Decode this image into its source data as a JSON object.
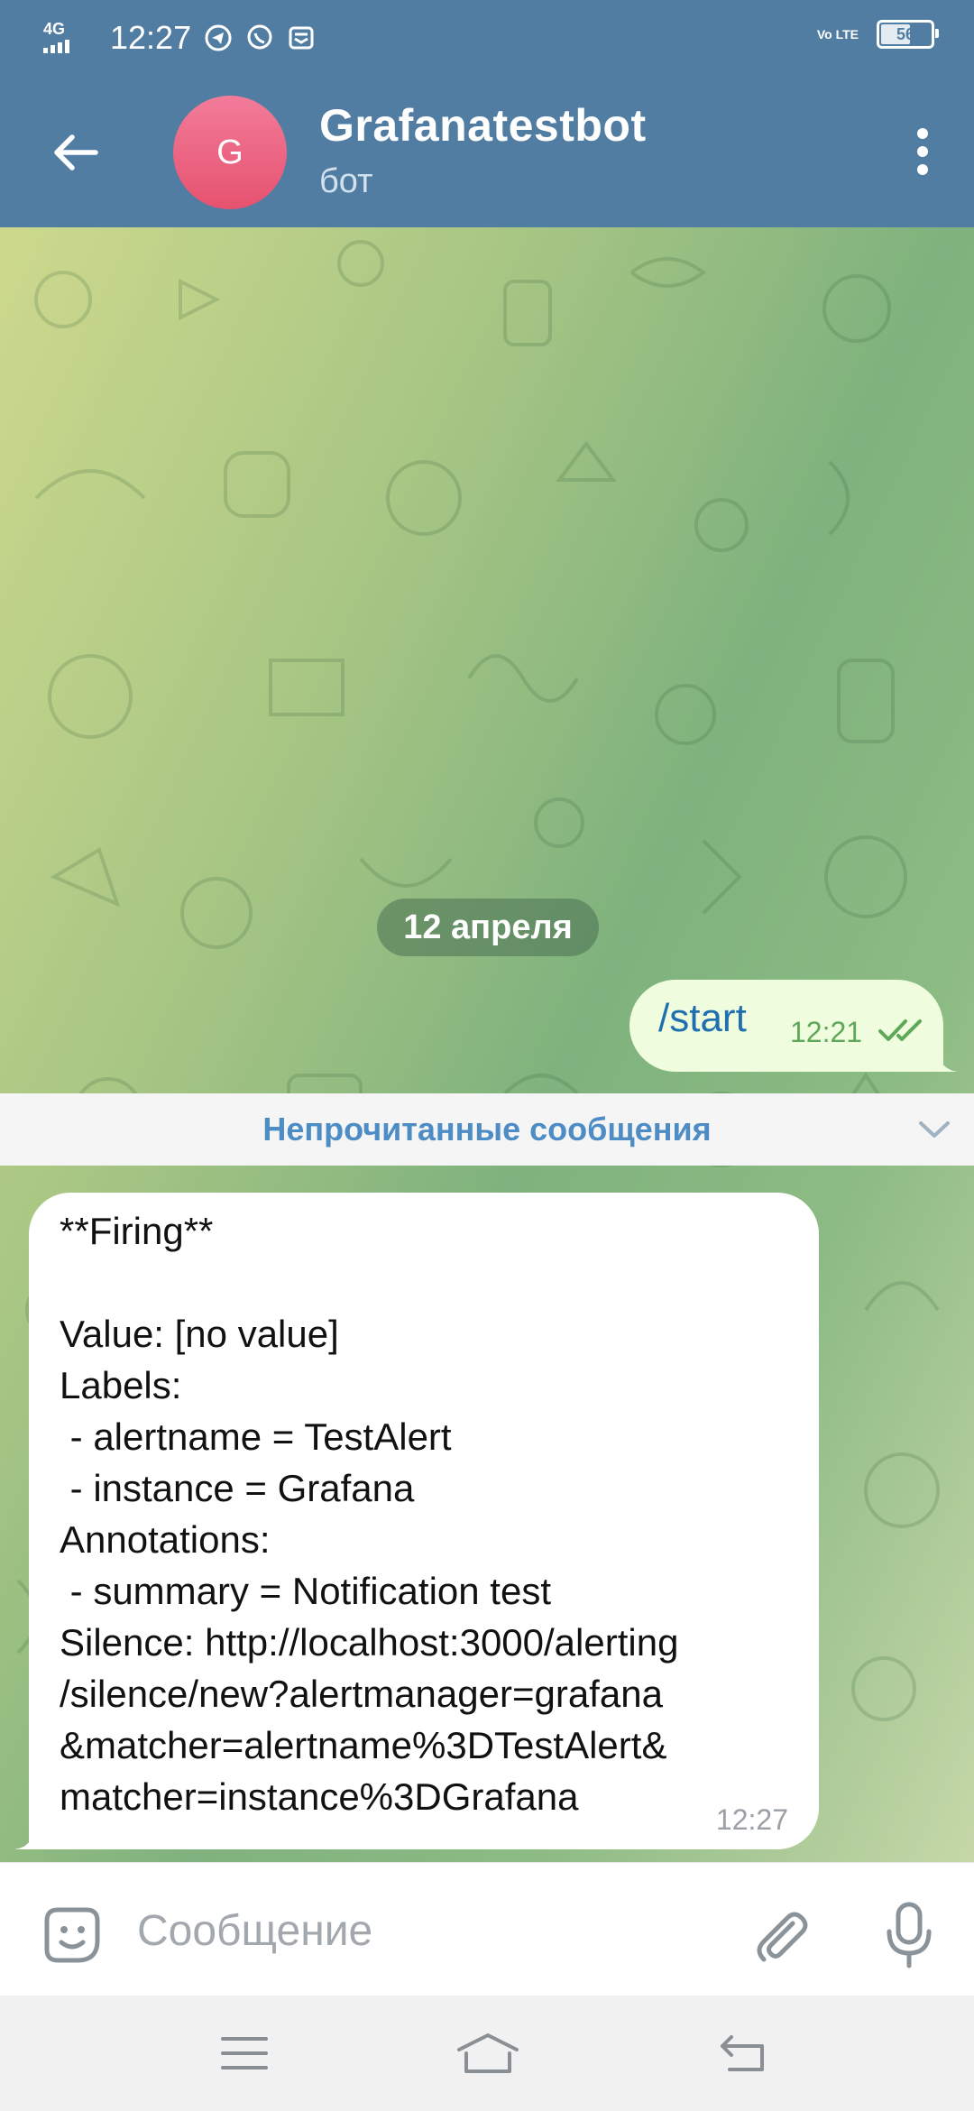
{
  "status_bar": {
    "network": "4G",
    "time": "12:27",
    "volte": "Vo LTE",
    "battery": "56"
  },
  "header": {
    "avatar_letter": "G",
    "title": "Grafanatestbot",
    "subtitle": "бот"
  },
  "chat": {
    "date_separator": "12 апреля",
    "outgoing": {
      "text": "/start",
      "time": "12:21"
    },
    "unread_label": "Непрочитанные сообщения",
    "incoming": {
      "text": "**Firing**\n\nValue: [no value]\nLabels:\n - alertname = TestAlert\n - instance = Grafana\nAnnotations:\n - summary = Notification test\nSilence: http://localhost:3000/alerting\n/silence/new?alertmanager=grafana\n&matcher=alertname%3DTestAlert&\nmatcher=instance%3DGrafana",
      "time": "12:27"
    }
  },
  "composer": {
    "placeholder": "Сообщение"
  },
  "colors": {
    "header": "#527da3",
    "outgoing_bubble": "#effdde",
    "incoming_bubble": "#ffffff",
    "accent": "#4d8cc4"
  },
  "icons": {
    "back": "arrow-left-icon",
    "menu": "more-vertical-icon",
    "emoji": "sticker-emoji-icon",
    "attach": "paperclip-icon",
    "mic": "microphone-icon",
    "read": "double-check-icon",
    "unread_chevron": "chevron-down-icon"
  }
}
